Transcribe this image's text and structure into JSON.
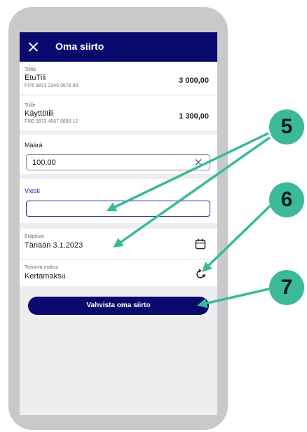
{
  "header": {
    "title": "Oma siirto",
    "close_icon": "close-icon"
  },
  "from_account": {
    "label": "Tililtä",
    "name": "EtuTili",
    "iban": "FI76 9871 2345 0678 90",
    "amount": "3 000,00"
  },
  "to_account": {
    "label": "Tilille",
    "name": "Käyttötili",
    "iban": "FI80 9873 4567 0890 12",
    "amount": "1 300,00"
  },
  "amount_field": {
    "label": "Määrä",
    "value": "100,00",
    "clear_icon": "clear-icon"
  },
  "message_field": {
    "label": "Viesti",
    "value": ""
  },
  "due_date": {
    "label": "Eräpäivä",
    "value": "Tänään 3.1.2023",
    "icon": "calendar-icon"
  },
  "recurring": {
    "label": "Toistuva maksu",
    "value": "Kertamaksu",
    "icon": "repeat-icon"
  },
  "confirm_button": {
    "label": "Vahvista oma siirto"
  },
  "callouts": {
    "badge_5": "5",
    "badge_6": "6",
    "badge_7": "7"
  },
  "colors": {
    "navy": "#0a0a6e",
    "accent_blue": "#1f2a9a",
    "teal": "#3bb99a",
    "screen_bg": "#eeeef1"
  }
}
